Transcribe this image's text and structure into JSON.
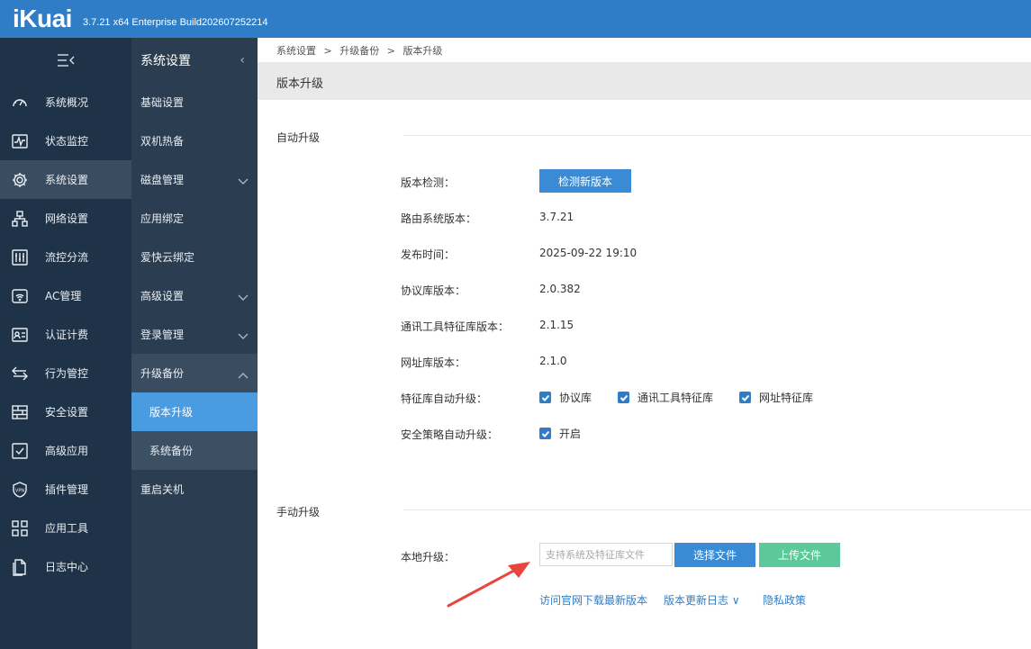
{
  "header": {
    "logo": "iKuai",
    "build": "3.7.21 x64 Enterprise Build202607252214"
  },
  "nav_primary": {
    "collapse_icon": "menu-collapse-icon",
    "items": [
      {
        "label": "系统概况",
        "icon": "dashboard-gauge-icon"
      },
      {
        "label": "状态监控",
        "icon": "pulse-monitor-icon"
      },
      {
        "label": "系统设置",
        "icon": "gear-icon"
      },
      {
        "label": "网络设置",
        "icon": "network-tree-icon"
      },
      {
        "label": "流控分流",
        "icon": "sliders-icon"
      },
      {
        "label": "AC管理",
        "icon": "wifi-ac-icon"
      },
      {
        "label": "认证计费",
        "icon": "id-card-icon"
      },
      {
        "label": "行为管控",
        "icon": "swap-arrows-icon"
      },
      {
        "label": "安全设置",
        "icon": "firewall-brick-icon"
      },
      {
        "label": "高级应用",
        "icon": "checkbox-app-icon"
      },
      {
        "label": "插件管理",
        "icon": "vpn-shield-icon"
      },
      {
        "label": "应用工具",
        "icon": "app-grid-icon"
      },
      {
        "label": "日志中心",
        "icon": "document-log-icon"
      }
    ]
  },
  "nav_secondary": {
    "title": "系统设置",
    "items": [
      {
        "label": "基础设置"
      },
      {
        "label": "双机热备"
      },
      {
        "label": "磁盘管理"
      },
      {
        "label": "应用绑定"
      },
      {
        "label": "爱快云绑定"
      },
      {
        "label": "高级设置"
      },
      {
        "label": "登录管理"
      },
      {
        "label": "升级备份"
      },
      {
        "label": "版本升级"
      },
      {
        "label": "系统备份"
      },
      {
        "label": "重启关机"
      }
    ]
  },
  "breadcrumb": {
    "a": "系统设置",
    "sep": ">",
    "b": "升级备份",
    "c": "版本升级"
  },
  "page_title": "版本升级",
  "auto_upgrade": {
    "section_title": "自动升级",
    "check_label": "版本检测：",
    "check_button": "检测新版本",
    "rows": [
      {
        "label": "路由系统版本：",
        "value": "3.7.21"
      },
      {
        "label": "发布时间：",
        "value": "2025-09-22 19:10"
      },
      {
        "label": "协议库版本：",
        "value": "2.0.382"
      },
      {
        "label": "通讯工具特征库版本：",
        "value": "2.1.15"
      },
      {
        "label": "网址库版本：",
        "value": "2.1.0"
      }
    ],
    "feature_label": "特征库自动升级：",
    "feature_options": [
      "协议库",
      "通讯工具特征库",
      "网址特征库"
    ],
    "policy_label": "安全策略自动升级：",
    "policy_option": "开启"
  },
  "manual_upgrade": {
    "section_title": "手动升级",
    "local_label": "本地升级：",
    "file_placeholder": "支持系统及特征库文件",
    "choose_button": "选择文件",
    "upload_button": "上传文件",
    "links": [
      "访问官网下载最新版本",
      "版本更新日志 ∨",
      "隐私政策"
    ]
  },
  "colors": {
    "header_blue": "#2f7dc7",
    "nav_dark": "#1f3348",
    "nav_secondary": "#2b3d50",
    "active_blue": "#4a9ce1",
    "upload_green": "#5cc99a",
    "arrow_red": "#e8453c"
  }
}
